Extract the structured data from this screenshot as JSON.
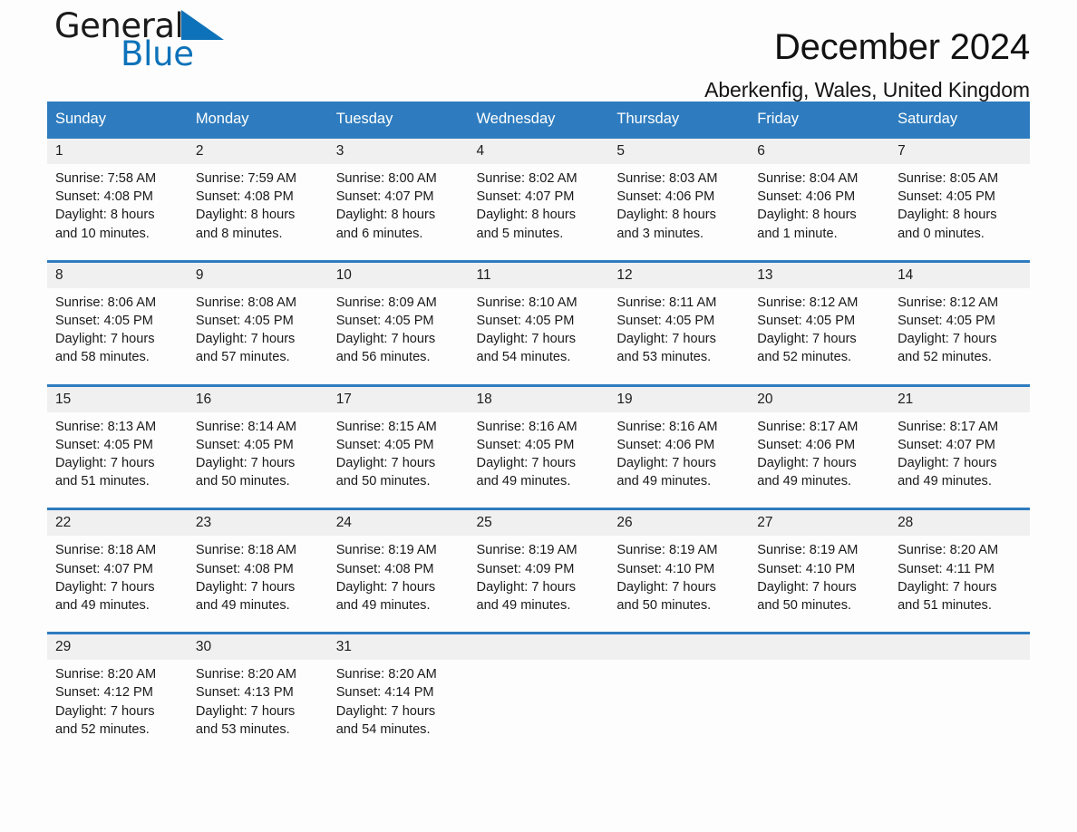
{
  "brand": {
    "word1": "General",
    "word2": "Blue",
    "logo_icon": "triangle-icon",
    "blue": "#0d72b9"
  },
  "header": {
    "title": "December 2024",
    "location": "Aberkenfig, Wales, United Kingdom"
  },
  "calendar": {
    "accent_color": "#2e7cbf",
    "daynum_band_color": "#f0f0f0",
    "day_names": [
      "Sunday",
      "Monday",
      "Tuesday",
      "Wednesday",
      "Thursday",
      "Friday",
      "Saturday"
    ],
    "weeks": [
      [
        {
          "day": "1",
          "lines": [
            "Sunrise: 7:58 AM",
            "Sunset: 4:08 PM",
            "Daylight: 8 hours",
            "and 10 minutes."
          ]
        },
        {
          "day": "2",
          "lines": [
            "Sunrise: 7:59 AM",
            "Sunset: 4:08 PM",
            "Daylight: 8 hours",
            "and 8 minutes."
          ]
        },
        {
          "day": "3",
          "lines": [
            "Sunrise: 8:00 AM",
            "Sunset: 4:07 PM",
            "Daylight: 8 hours",
            "and 6 minutes."
          ]
        },
        {
          "day": "4",
          "lines": [
            "Sunrise: 8:02 AM",
            "Sunset: 4:07 PM",
            "Daylight: 8 hours",
            "and 5 minutes."
          ]
        },
        {
          "day": "5",
          "lines": [
            "Sunrise: 8:03 AM",
            "Sunset: 4:06 PM",
            "Daylight: 8 hours",
            "and 3 minutes."
          ]
        },
        {
          "day": "6",
          "lines": [
            "Sunrise: 8:04 AM",
            "Sunset: 4:06 PM",
            "Daylight: 8 hours",
            "and 1 minute."
          ]
        },
        {
          "day": "7",
          "lines": [
            "Sunrise: 8:05 AM",
            "Sunset: 4:05 PM",
            "Daylight: 8 hours",
            "and 0 minutes."
          ]
        }
      ],
      [
        {
          "day": "8",
          "lines": [
            "Sunrise: 8:06 AM",
            "Sunset: 4:05 PM",
            "Daylight: 7 hours",
            "and 58 minutes."
          ]
        },
        {
          "day": "9",
          "lines": [
            "Sunrise: 8:08 AM",
            "Sunset: 4:05 PM",
            "Daylight: 7 hours",
            "and 57 minutes."
          ]
        },
        {
          "day": "10",
          "lines": [
            "Sunrise: 8:09 AM",
            "Sunset: 4:05 PM",
            "Daylight: 7 hours",
            "and 56 minutes."
          ]
        },
        {
          "day": "11",
          "lines": [
            "Sunrise: 8:10 AM",
            "Sunset: 4:05 PM",
            "Daylight: 7 hours",
            "and 54 minutes."
          ]
        },
        {
          "day": "12",
          "lines": [
            "Sunrise: 8:11 AM",
            "Sunset: 4:05 PM",
            "Daylight: 7 hours",
            "and 53 minutes."
          ]
        },
        {
          "day": "13",
          "lines": [
            "Sunrise: 8:12 AM",
            "Sunset: 4:05 PM",
            "Daylight: 7 hours",
            "and 52 minutes."
          ]
        },
        {
          "day": "14",
          "lines": [
            "Sunrise: 8:12 AM",
            "Sunset: 4:05 PM",
            "Daylight: 7 hours",
            "and 52 minutes."
          ]
        }
      ],
      [
        {
          "day": "15",
          "lines": [
            "Sunrise: 8:13 AM",
            "Sunset: 4:05 PM",
            "Daylight: 7 hours",
            "and 51 minutes."
          ]
        },
        {
          "day": "16",
          "lines": [
            "Sunrise: 8:14 AM",
            "Sunset: 4:05 PM",
            "Daylight: 7 hours",
            "and 50 minutes."
          ]
        },
        {
          "day": "17",
          "lines": [
            "Sunrise: 8:15 AM",
            "Sunset: 4:05 PM",
            "Daylight: 7 hours",
            "and 50 minutes."
          ]
        },
        {
          "day": "18",
          "lines": [
            "Sunrise: 8:16 AM",
            "Sunset: 4:05 PM",
            "Daylight: 7 hours",
            "and 49 minutes."
          ]
        },
        {
          "day": "19",
          "lines": [
            "Sunrise: 8:16 AM",
            "Sunset: 4:06 PM",
            "Daylight: 7 hours",
            "and 49 minutes."
          ]
        },
        {
          "day": "20",
          "lines": [
            "Sunrise: 8:17 AM",
            "Sunset: 4:06 PM",
            "Daylight: 7 hours",
            "and 49 minutes."
          ]
        },
        {
          "day": "21",
          "lines": [
            "Sunrise: 8:17 AM",
            "Sunset: 4:07 PM",
            "Daylight: 7 hours",
            "and 49 minutes."
          ]
        }
      ],
      [
        {
          "day": "22",
          "lines": [
            "Sunrise: 8:18 AM",
            "Sunset: 4:07 PM",
            "Daylight: 7 hours",
            "and 49 minutes."
          ]
        },
        {
          "day": "23",
          "lines": [
            "Sunrise: 8:18 AM",
            "Sunset: 4:08 PM",
            "Daylight: 7 hours",
            "and 49 minutes."
          ]
        },
        {
          "day": "24",
          "lines": [
            "Sunrise: 8:19 AM",
            "Sunset: 4:08 PM",
            "Daylight: 7 hours",
            "and 49 minutes."
          ]
        },
        {
          "day": "25",
          "lines": [
            "Sunrise: 8:19 AM",
            "Sunset: 4:09 PM",
            "Daylight: 7 hours",
            "and 49 minutes."
          ]
        },
        {
          "day": "26",
          "lines": [
            "Sunrise: 8:19 AM",
            "Sunset: 4:10 PM",
            "Daylight: 7 hours",
            "and 50 minutes."
          ]
        },
        {
          "day": "27",
          "lines": [
            "Sunrise: 8:19 AM",
            "Sunset: 4:10 PM",
            "Daylight: 7 hours",
            "and 50 minutes."
          ]
        },
        {
          "day": "28",
          "lines": [
            "Sunrise: 8:20 AM",
            "Sunset: 4:11 PM",
            "Daylight: 7 hours",
            "and 51 minutes."
          ]
        }
      ],
      [
        {
          "day": "29",
          "lines": [
            "Sunrise: 8:20 AM",
            "Sunset: 4:12 PM",
            "Daylight: 7 hours",
            "and 52 minutes."
          ]
        },
        {
          "day": "30",
          "lines": [
            "Sunrise: 8:20 AM",
            "Sunset: 4:13 PM",
            "Daylight: 7 hours",
            "and 53 minutes."
          ]
        },
        {
          "day": "31",
          "lines": [
            "Sunrise: 8:20 AM",
            "Sunset: 4:14 PM",
            "Daylight: 7 hours",
            "and 54 minutes."
          ]
        },
        {
          "day": "",
          "lines": []
        },
        {
          "day": "",
          "lines": []
        },
        {
          "day": "",
          "lines": []
        },
        {
          "day": "",
          "lines": []
        }
      ]
    ]
  }
}
